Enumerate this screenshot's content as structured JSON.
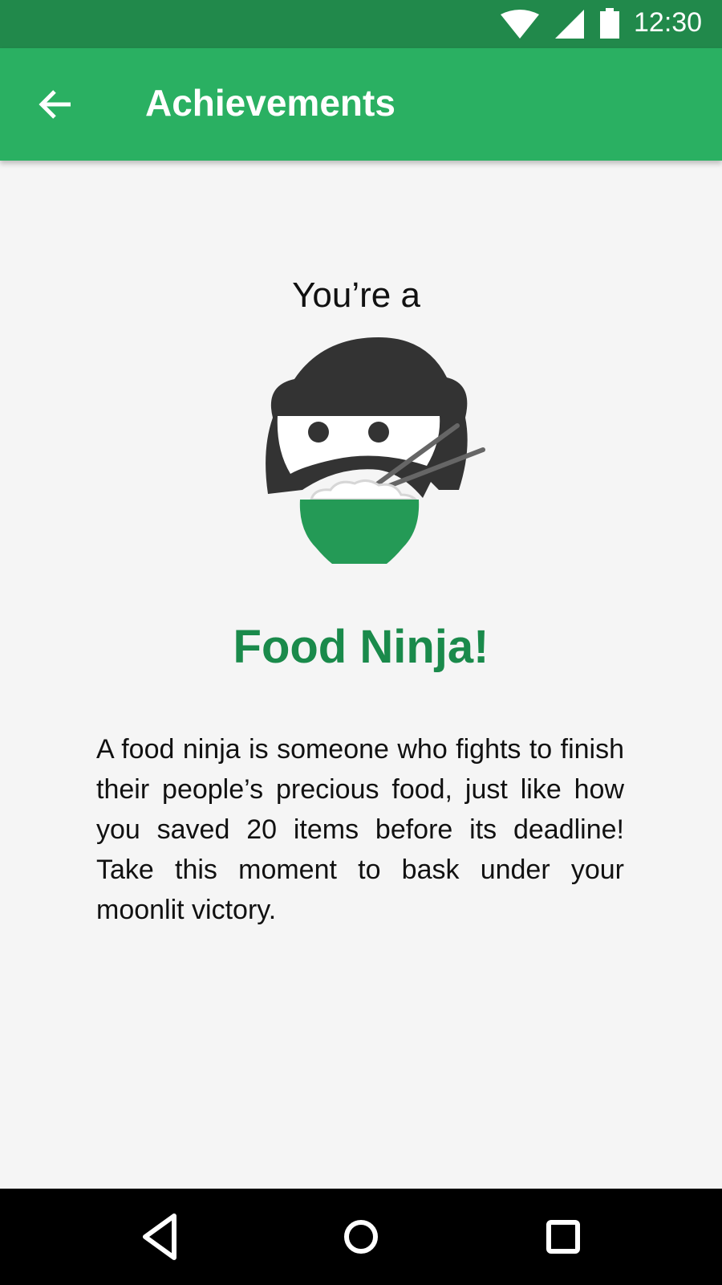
{
  "status_bar": {
    "time": "12:30",
    "icons": [
      "wifi-icon",
      "cell-signal-icon",
      "battery-icon"
    ]
  },
  "app_bar": {
    "title": "Achievements",
    "back_icon": "arrow-left-icon"
  },
  "achievement": {
    "intro": "You’re a",
    "illustration": "food-ninja-icon",
    "name": "Food Ninja!",
    "description": "A food ninja is someone who fights to finish their people’s precious food, just like how you saved 20 items before its deadline! Take this moment to bask under your moonlit victory."
  },
  "nav_bar": {
    "icons": [
      "nav-back-icon",
      "nav-home-icon",
      "nav-recents-icon"
    ]
  },
  "colors": {
    "status_bar": "#21894b",
    "app_bar": "#2ab062",
    "accent_text": "#1a8a4b",
    "ninja": "#333333",
    "bowl": "#249a56",
    "background": "#f5f5f5"
  }
}
